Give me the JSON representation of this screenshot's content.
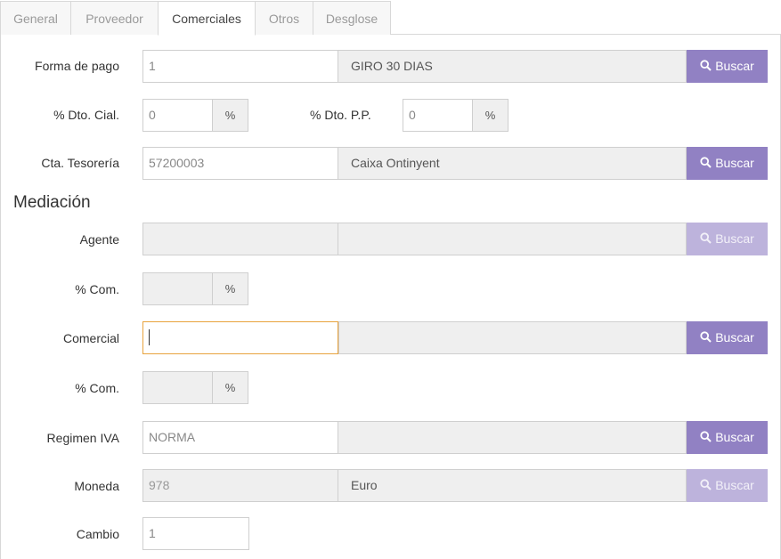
{
  "tabs": [
    {
      "label": "General",
      "active": false
    },
    {
      "label": "Proveedor",
      "active": false
    },
    {
      "label": "Comerciales",
      "active": true
    },
    {
      "label": "Otros",
      "active": false
    },
    {
      "label": "Desglose",
      "active": false
    }
  ],
  "search_label": "Buscar",
  "percent_symbol": "%",
  "icons": {
    "search": "search-icon"
  },
  "colors": {
    "button": "#9181c3",
    "button_disabled": "#bdb3dc",
    "focus_border": "#e8a33d"
  },
  "form": {
    "forma_pago": {
      "label": "Forma de pago",
      "code": "1",
      "description": "GIRO 30 DIAS"
    },
    "dto_cial": {
      "label": "% Dto. Cial.",
      "value": "0"
    },
    "dto_pp": {
      "label": "% Dto. P.P.",
      "value": "0"
    },
    "cta_tesoreria": {
      "label": "Cta. Tesorería",
      "code": "57200003",
      "description": "Caixa Ontinyent"
    },
    "mediacion_title": "Mediación",
    "agente": {
      "label": "Agente",
      "code": "",
      "description": ""
    },
    "com_agente": {
      "label": "% Com.",
      "value": ""
    },
    "comercial": {
      "label": "Comercial",
      "code": "",
      "description": ""
    },
    "com_comercial": {
      "label": "% Com.",
      "value": ""
    },
    "regimen_iva": {
      "label": "Regimen IVA",
      "code": "NORMA",
      "description": ""
    },
    "moneda": {
      "label": "Moneda",
      "code": "978",
      "description": "Euro"
    },
    "cambio": {
      "label": "Cambio",
      "value": "1"
    }
  }
}
